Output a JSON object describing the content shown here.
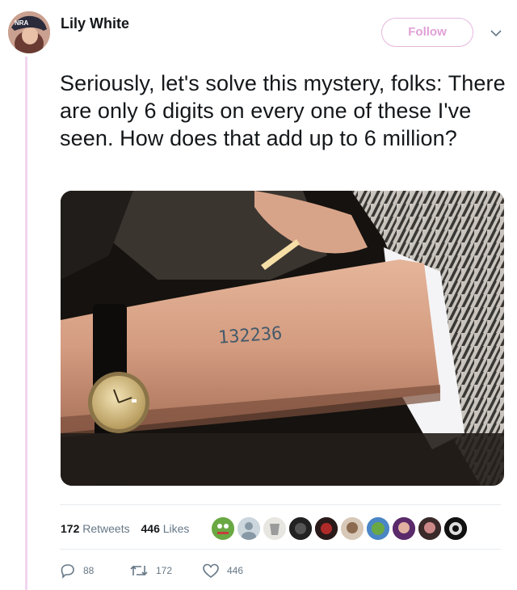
{
  "tweet": {
    "author_name": "Lily White",
    "follow_label": "Follow",
    "text": "Seriously, let's solve this mystery, folks: There are only 6 digits on every one of these I've seen. How does that add up to 6 million?",
    "avatar_cap_text": "NRA",
    "media": {
      "tattoo_text": "132236"
    }
  },
  "stats": {
    "retweets_count": "172",
    "retweets_label": "Retweets",
    "likes_count": "446",
    "likes_label": "Likes"
  },
  "actions": {
    "reply_count": "88",
    "retweet_count": "172",
    "like_count": "446"
  },
  "colors": {
    "accent": "#e0a0d6",
    "thread_line": "#f1d6ef",
    "muted": "#657786"
  }
}
